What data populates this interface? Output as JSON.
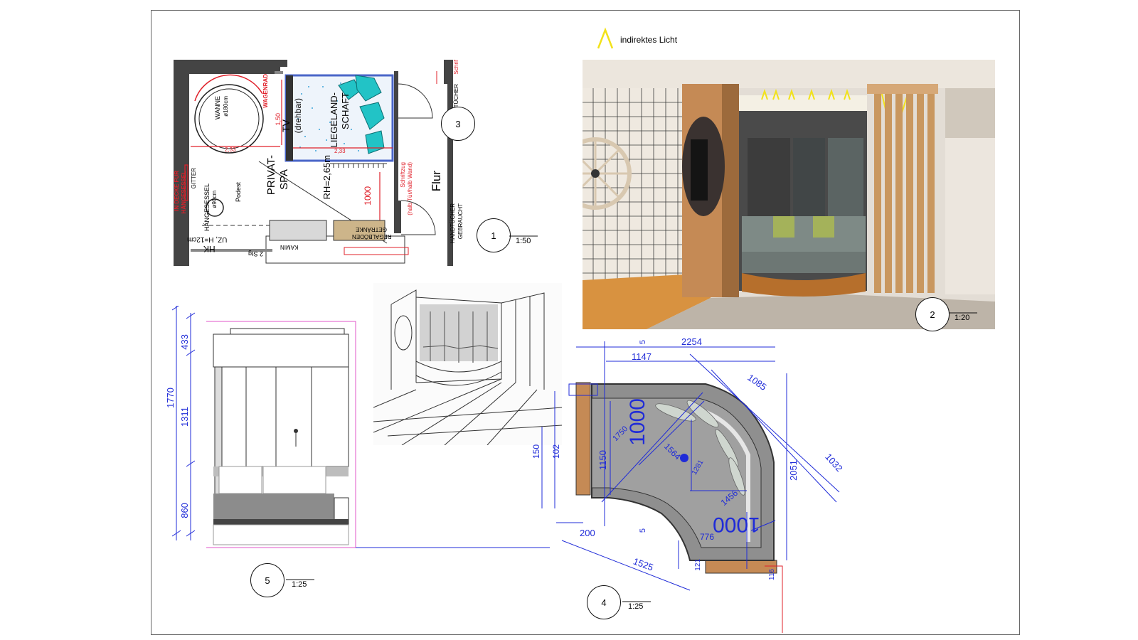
{
  "legend": {
    "indirect_light_label": "indirektes Licht"
  },
  "plan1": {
    "callout": "1",
    "scale": "1:50",
    "section_ref": "3",
    "labels": {
      "wanne": "WANNE",
      "wanne_dim": "ø180cm",
      "wagenrad": "WAGENRAD",
      "tv": "TV",
      "drehbar": "(drehbar)",
      "liege1": "LIEGELAND-",
      "liege2": "SCHAFT",
      "privat1": "PRIVAT-",
      "privat2": "SPA",
      "rh": "RH=2,65m",
      "flur": "Flur",
      "dim_150": "1,50",
      "dim_233a": "2,33",
      "dim_233b": "2,33",
      "dim_1000": "1000",
      "schriftzug": "Schriftzug",
      "schriftzug2": "(halb Tür/halb Wand)",
      "decke1": "IN DECKE FÜR",
      "decke2": "HÄNGESESSEL",
      "gitter": "GITTER",
      "haenge": "HÄNGESESSEL",
      "haenge_dim": "ø90cm",
      "podest": "Podest",
      "uz": "UZ, H=12cm",
      "hk": "HK",
      "stg": "2 Stg",
      "kamin": "KAMIN",
      "regal": "REGALBÖDEN",
      "getraenke": "GETRÄNKE",
      "handtuch1": "HANDTÜCHER",
      "handtuch2": "GEBRAUCHT",
      "tuecher": "TÜCHER",
      "schrif": "Schrif"
    }
  },
  "render2": {
    "callout": "2",
    "scale": "1:20"
  },
  "elevation5": {
    "callout": "5",
    "scale": "1:25",
    "dims": {
      "total": "1770",
      "top": "433",
      "mid": "1311",
      "bottom": "860"
    }
  },
  "plan4": {
    "callout": "4",
    "scale": "1:25",
    "dims": {
      "d2254": "2254",
      "d1147": "1147",
      "d1085": "1085",
      "d1032": "1032",
      "d2051": "2051",
      "d1150": "1150",
      "d1564": "1564",
      "d1456": "1456",
      "d1000a": "1000",
      "d1000b": "1000",
      "d776": "776",
      "d200": "200",
      "d1525": "1525",
      "d5a": "5",
      "d5b": "5",
      "d150": "150",
      "d102": "102",
      "d1750": "1750",
      "d1281": "1281",
      "d116": "116",
      "d121": "121"
    }
  },
  "colors": {
    "dim_blue": "#1f2bd8",
    "annot_red": "#e0202a",
    "wood": "#c58a55",
    "teal": "#22c3c6",
    "magenta": "#e055c8"
  }
}
